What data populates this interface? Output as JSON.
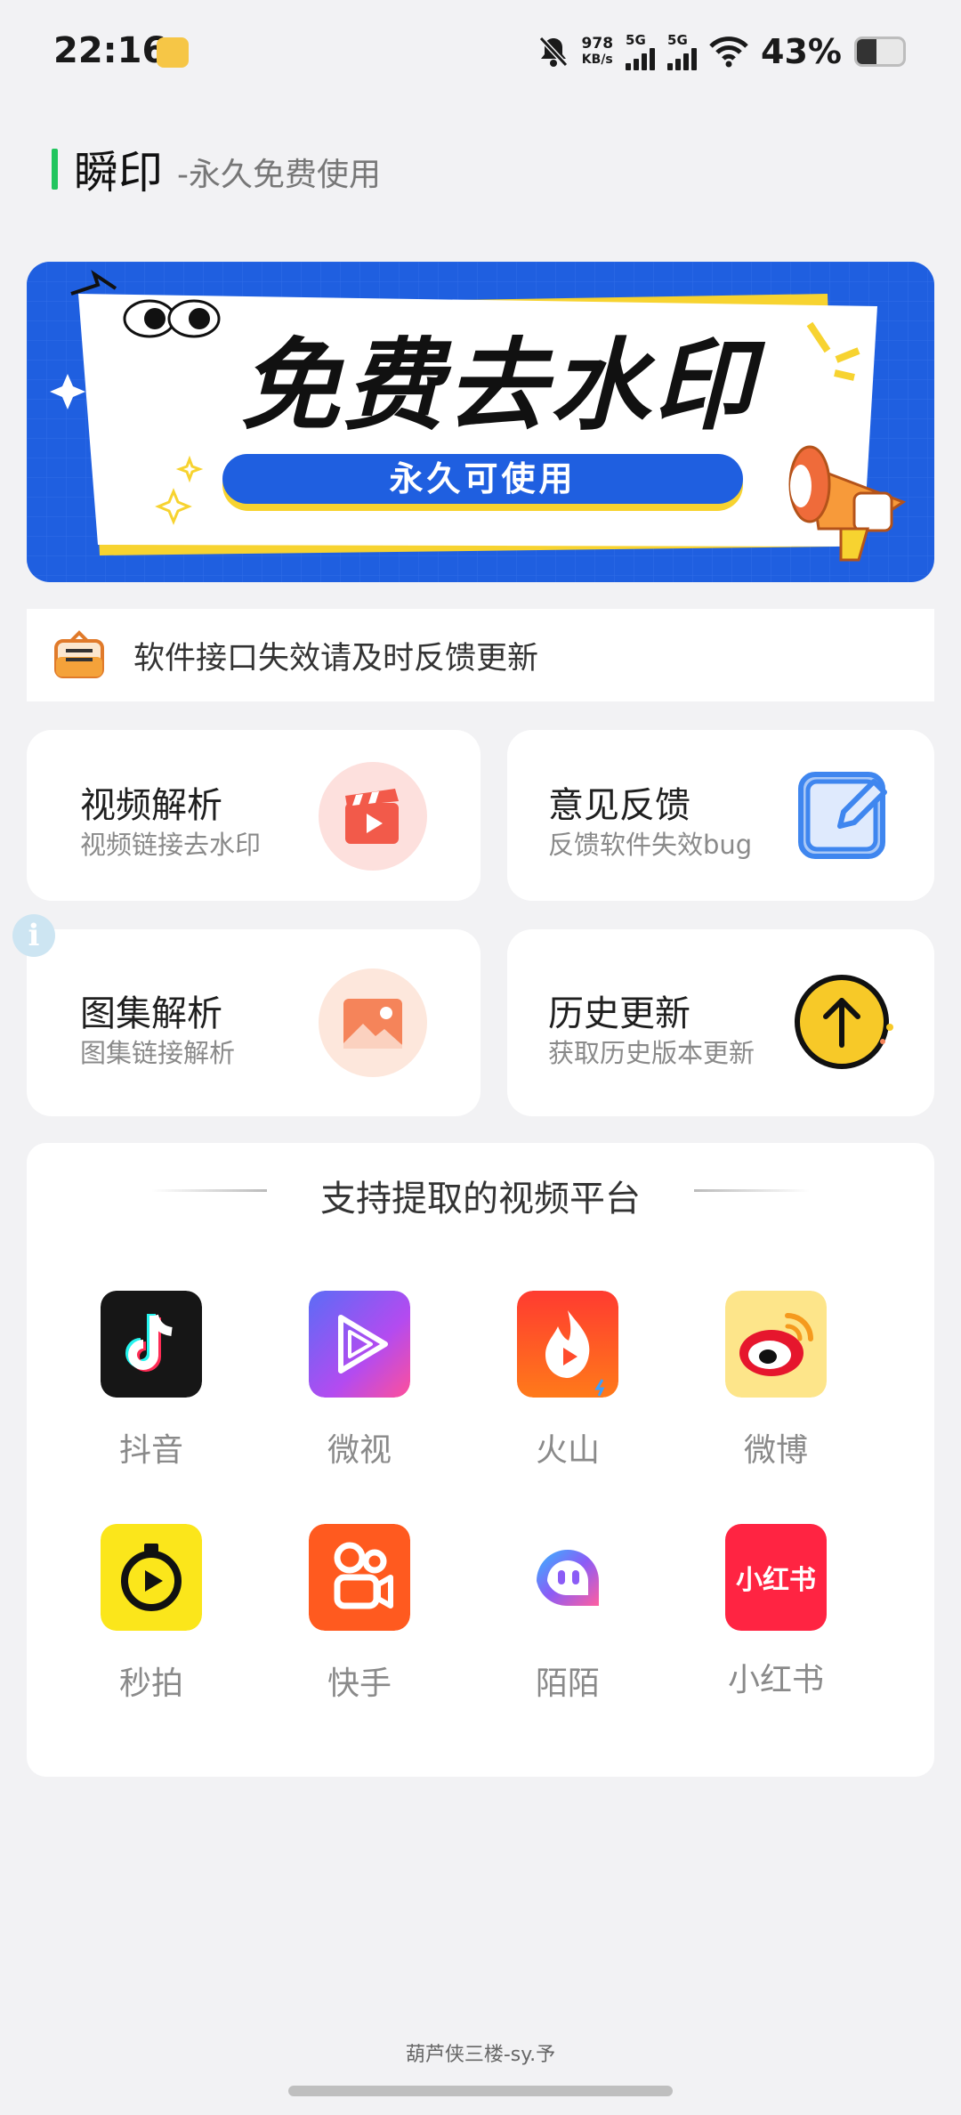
{
  "status_bar": {
    "time": "22:16",
    "net_speed_value": "978",
    "net_speed_unit": "KB/s",
    "sim1_label": "5G",
    "sim2_label": "5G",
    "battery_percent_text": "43%",
    "battery_level": 0.43
  },
  "header": {
    "app_name": "瞬印",
    "tagline": "-永久免费使用"
  },
  "banner": {
    "headline": "免费去水印",
    "pill_text": "永久可使用"
  },
  "notice": {
    "text": "软件接口失效请及时反馈更新"
  },
  "features": [
    {
      "title": "视频解析",
      "subtitle": "视频链接去水印",
      "icon": "video-clapper-icon"
    },
    {
      "title": "意见反馈",
      "subtitle": "反馈软件失效bug",
      "icon": "edit-note-icon"
    },
    {
      "title": "图集解析",
      "subtitle": "图集链接解析",
      "icon": "image-icon"
    },
    {
      "title": "历史更新",
      "subtitle": "获取历史版本更新",
      "icon": "upload-arrow-icon"
    }
  ],
  "platforms": {
    "title": "支持提取的视频平台",
    "items": [
      {
        "label": "抖音",
        "icon": "douyin-logo-icon"
      },
      {
        "label": "微视",
        "icon": "weishi-logo-icon"
      },
      {
        "label": "火山",
        "icon": "huoshan-logo-icon"
      },
      {
        "label": "微博",
        "icon": "weibo-logo-icon"
      },
      {
        "label": "秒拍",
        "icon": "miaopai-logo-icon"
      },
      {
        "label": "快手",
        "icon": "kuaishou-logo-icon"
      },
      {
        "label": "陌陌",
        "icon": "momo-logo-icon"
      },
      {
        "label": "小红书",
        "icon": "xiaohongshu-logo-icon",
        "logo_text": "小红书"
      }
    ]
  },
  "footer": {
    "credit": "葫芦侠三楼-sy.予"
  },
  "colors": {
    "accent_green": "#22c55e",
    "banner_blue": "#1f5fe0",
    "banner_yellow": "#f7d330"
  }
}
